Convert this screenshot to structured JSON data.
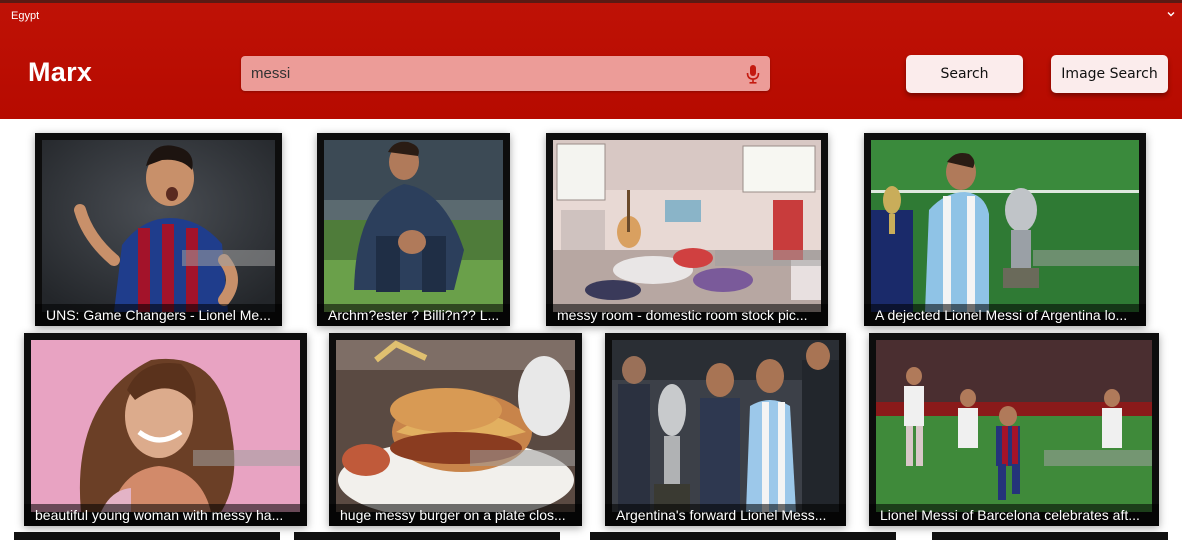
{
  "header": {
    "region": "Egypt",
    "brand": "Marx",
    "search": {
      "value": "messi"
    },
    "search_button": "Search",
    "image_search_button": "Image Search"
  },
  "colors": {
    "header_bg": "#b80c00",
    "search_bg": "#ec9c98",
    "button_bg": "#fbecec"
  },
  "results": [
    {
      "caption": "UNS: Game Changers - Lionel Me..."
    },
    {
      "caption": "Archm?ester ? Billi?n?? L..."
    },
    {
      "caption": "messy room - domestic room stock pic..."
    },
    {
      "caption": "A dejected Lionel Messi of Argentina lo..."
    },
    {
      "caption": "beautiful young woman with messy ha..."
    },
    {
      "caption": "huge messy burger on a plate clos..."
    },
    {
      "caption": "Argentina's forward Lionel Mess..."
    },
    {
      "caption": "Lionel Messi of Barcelona celebrates aft..."
    }
  ]
}
